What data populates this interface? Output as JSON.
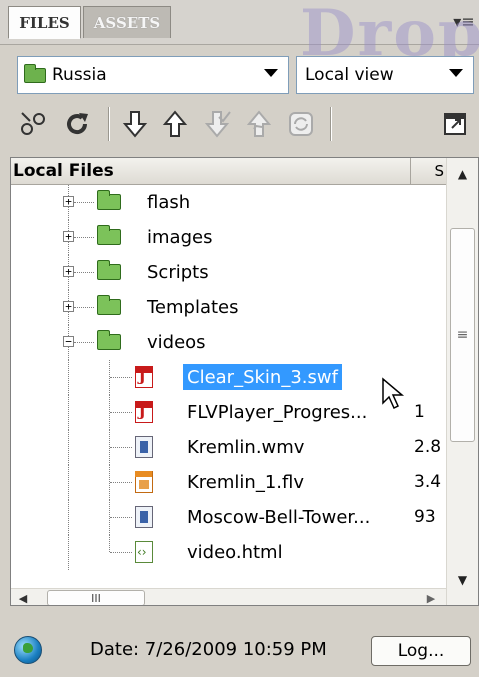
{
  "tabs": [
    {
      "label": "FILES",
      "active": true
    },
    {
      "label": "ASSETS",
      "active": false
    }
  ],
  "panel_menu_icon": "options-menu-icon",
  "watermark": "Drop",
  "site_selector": {
    "value": "Russia",
    "icon": "folder-icon"
  },
  "view_selector": {
    "value": "Local view"
  },
  "toolbar": {
    "buttons": [
      {
        "name": "connect-icon",
        "enabled": true
      },
      {
        "name": "refresh-icon",
        "enabled": true
      },
      {
        "name": "get-icon",
        "enabled": true
      },
      {
        "name": "put-icon",
        "enabled": true
      },
      {
        "name": "check-out-icon",
        "enabled": false
      },
      {
        "name": "check-in-icon",
        "enabled": false
      },
      {
        "name": "synchronize-icon",
        "enabled": false
      },
      {
        "name": "expand-icon",
        "enabled": true
      }
    ]
  },
  "columns": {
    "local_files": "Local Files",
    "size": "S"
  },
  "tree": [
    {
      "type": "folder",
      "name": "flash",
      "expanded": false
    },
    {
      "type": "folder",
      "name": "images",
      "expanded": false
    },
    {
      "type": "folder",
      "name": "Scripts",
      "expanded": false
    },
    {
      "type": "folder",
      "name": "Templates",
      "expanded": false
    },
    {
      "type": "folder",
      "name": "videos",
      "expanded": true
    },
    {
      "type": "file",
      "kind": "swf",
      "name": "Clear_Skin_3.swf",
      "size": "",
      "selected": true
    },
    {
      "type": "file",
      "kind": "swf",
      "name": "FLVPlayer_Progres...",
      "size": "1"
    },
    {
      "type": "file",
      "kind": "wmv",
      "name": "Kremlin.wmv",
      "size": "2.8"
    },
    {
      "type": "file",
      "kind": "flv",
      "name": "Kremlin_1.flv",
      "size": "3.4"
    },
    {
      "type": "file",
      "kind": "wmv",
      "name": "Moscow-Bell-Tower...",
      "size": "93"
    },
    {
      "type": "file",
      "kind": "html",
      "name": "video.html",
      "size": ""
    }
  ],
  "scrollbar": {
    "h_thumb_grip": "III",
    "v_thumb_grip": "≡"
  },
  "status": {
    "text": "Date: 7/26/2009 10:59 PM",
    "log_button": "Log..."
  },
  "colors": {
    "selection": "#3399ff",
    "folder": "#7cc25a",
    "background": "#d4d0c8"
  }
}
